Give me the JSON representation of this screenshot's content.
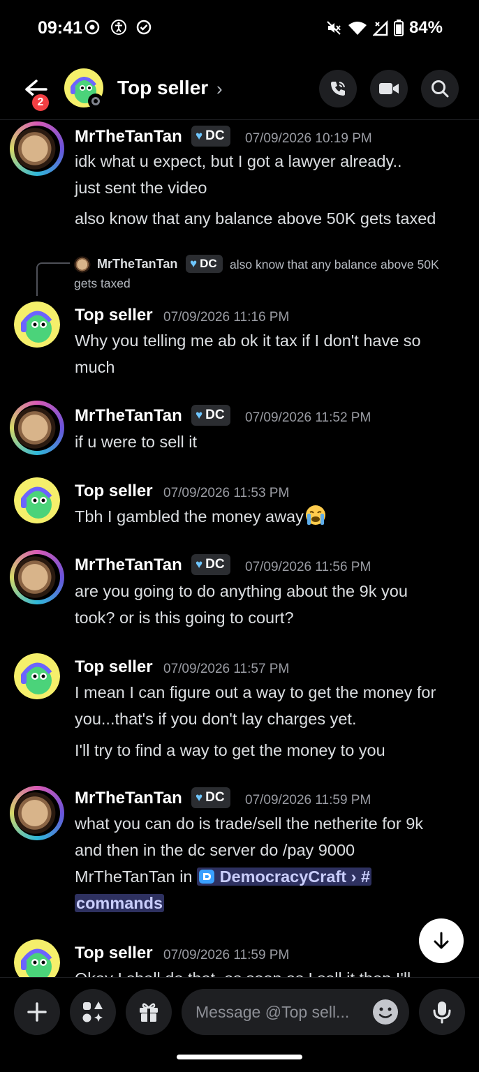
{
  "status_bar": {
    "time": "09:41",
    "battery": "84%"
  },
  "header": {
    "title": "Top seller",
    "chevron": "›",
    "unread_badge": "2"
  },
  "messages": [
    {
      "author": "MrTheTanTan",
      "tag": "DC",
      "time": "07/09/2026 10:19 PM",
      "lines": [
        "idk what u expect, but I got a lawyer already..",
        "just sent the video"
      ],
      "extra": "also know that any balance above 50K gets taxed"
    },
    {
      "reply_author": "MrTheTanTan",
      "reply_tag": "DC",
      "reply_text": "also know that any balance above 50K",
      "reply_text2": "gets taxed"
    },
    {
      "author": "Top seller",
      "time": "07/09/2026 11:16 PM",
      "lines": [
        "Why you telling me ab ok it tax if I don't have so",
        "much"
      ]
    },
    {
      "author": "MrTheTanTan",
      "tag": "DC",
      "time": "07/09/2026 11:52 PM",
      "lines": [
        "if u were to sell it"
      ]
    },
    {
      "author": "Top seller",
      "time": "07/09/2026 11:53 PM",
      "lines": [
        "Tbh I gambled the money away"
      ]
    },
    {
      "author": "MrTheTanTan",
      "tag": "DC",
      "time": "07/09/2026 11:56 PM",
      "lines": [
        "are you going to do anything about the 9k you",
        "took? or is this going to court?"
      ]
    },
    {
      "author": "Top seller",
      "time": "07/09/2026 11:57 PM",
      "lines": [
        "I mean I can figure out a way to get the money for",
        "you...that's if you don't lay charges yet."
      ],
      "extra": "I'll try to find a way to get the money to you"
    },
    {
      "author": "MrTheTanTan",
      "tag": "DC",
      "time": "07/09/2026 11:59 PM",
      "lines": [
        "what you can do is trade/sell the netherite for 9k",
        "and then in the dc server do /pay 9000",
        "MrTheTanTan in "
      ],
      "mention_server": "DemocracyCraft",
      "mention_channel": "commands"
    },
    {
      "author": "Top seller",
      "time": "07/09/2026 11:59 PM",
      "lines": [
        "Okay I shall do that, as soon as I sell it then I'll"
      ]
    }
  ],
  "composer": {
    "placeholder": "Message @Top sell..."
  }
}
